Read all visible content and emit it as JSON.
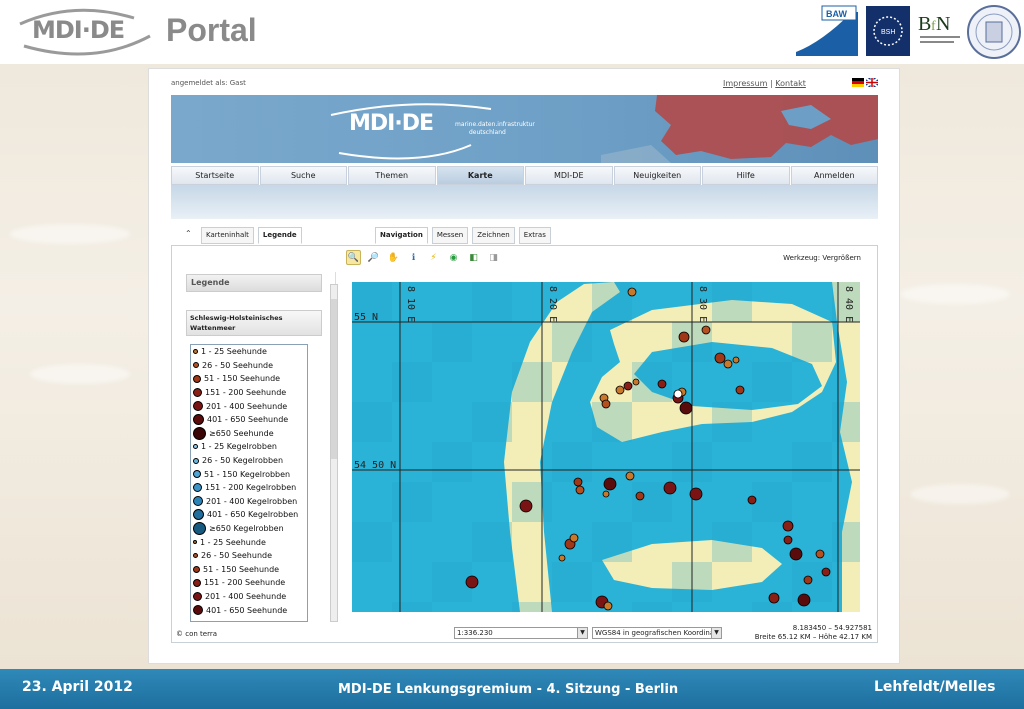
{
  "slide": {
    "logo_text": "MDI·DE",
    "title": "Portal",
    "partner_logos": [
      "BAW",
      "BSH",
      "BfN",
      "university-seal"
    ]
  },
  "browser": {
    "login_status": "angemeldet als: Gast",
    "top_links": [
      "Impressum",
      "Kontakt"
    ],
    "flags": [
      "flag-de-icon",
      "flag-uk-icon"
    ],
    "banner": {
      "logo": "MDI·DE",
      "tagline_line1": "marine.daten.infrastruktur",
      "tagline_line2": "deutschland"
    },
    "nav_tabs": [
      {
        "label": "Startseite",
        "active": false
      },
      {
        "label": "Suche",
        "active": false
      },
      {
        "label": "Themen",
        "active": false
      },
      {
        "label": "Karte",
        "active": true
      },
      {
        "label": "MDI-DE",
        "active": false
      },
      {
        "label": "Neuigkeiten",
        "active": false
      },
      {
        "label": "Hilfe",
        "active": false
      },
      {
        "label": "Anmelden",
        "active": false
      }
    ],
    "left_tabs": [
      {
        "label": "Karteninhalt",
        "active": false
      },
      {
        "label": "Legende",
        "active": true
      }
    ],
    "right_tabs": [
      {
        "label": "Navigation",
        "active": true
      },
      {
        "label": "Messen",
        "active": false
      },
      {
        "label": "Zeichnen",
        "active": false
      },
      {
        "label": "Extras",
        "active": false
      }
    ],
    "toolbar_icons": [
      "zoom-in-icon",
      "zoom-out-icon",
      "pan-hand-icon",
      "info-icon",
      "lightning-icon",
      "globe-icon",
      "back-icon",
      "forward-icon"
    ],
    "werkzeug": "Werkzeug: Vergrößern",
    "legend": {
      "header": "Legende",
      "group_title": "Schleswig-Holsteinisches Wattenmeer",
      "items": [
        {
          "label": "1 - 25 Seehunde",
          "color": "#c8782a",
          "size": 5
        },
        {
          "label": "26 - 50 Seehunde",
          "color": "#b55020",
          "size": 6
        },
        {
          "label": "51 - 150 Seehunde",
          "color": "#a03818",
          "size": 8
        },
        {
          "label": "151 - 200 Seehunde",
          "color": "#8a1f16",
          "size": 9
        },
        {
          "label": "201 - 400 Seehunde",
          "color": "#7a1414",
          "size": 10
        },
        {
          "label": "401 - 650 Seehunde",
          "color": "#5a0c0c",
          "size": 11
        },
        {
          "label": "≥650 Seehunde",
          "color": "#3a0505",
          "size": 13
        },
        {
          "label": "1 - 25 Kegelrobben",
          "color": "#8fd0ee",
          "size": 5
        },
        {
          "label": "26 - 50 Kegelrobben",
          "color": "#6ab8e0",
          "size": 6
        },
        {
          "label": "51 - 150 Kegelrobben",
          "color": "#4ea6d6",
          "size": 8
        },
        {
          "label": "151 - 200 Kegelrobben",
          "color": "#3a94c8",
          "size": 9
        },
        {
          "label": "201 - 400 Kegelrobben",
          "color": "#2b84b8",
          "size": 10
        },
        {
          "label": "401 - 650 Kegelrobben",
          "color": "#1f6e9e",
          "size": 11
        },
        {
          "label": "≥650 Kegelrobben",
          "color": "#175a7f",
          "size": 13
        },
        {
          "label": "1 - 25 Seehunde",
          "color": "#c8782a",
          "size": 4
        },
        {
          "label": "26 - 50 Seehunde",
          "color": "#b55020",
          "size": 5
        },
        {
          "label": "51 - 150 Seehunde",
          "color": "#a03818",
          "size": 7
        },
        {
          "label": "151 - 200 Seehunde",
          "color": "#8a1f16",
          "size": 8
        },
        {
          "label": "201 - 400 Seehunde",
          "color": "#7a1414",
          "size": 9
        },
        {
          "label": "401 - 650 Seehunde",
          "color": "#5a0c0c",
          "size": 10
        }
      ]
    },
    "map": {
      "lon_labels": [
        "8 10 E",
        "8 20 E",
        "8 30 E",
        "8 40 E"
      ],
      "lat_labels": [
        "55 N",
        "54 50 N"
      ],
      "water_color": "#2ab3d6",
      "land_color": "#f3eeb8"
    },
    "status": {
      "copyright": "© con terra",
      "scale": "1:336.230",
      "crs": "WGS84 in geografischen Koordinaten",
      "coords": "8.183450 – 54.927581",
      "extent": "Breite 65.12 KM – Höhe 42.17 KM"
    }
  },
  "footer": {
    "date": "23. April 2012",
    "center": "MDI-DE Lenkungsgremium - 4. Sitzung - Berlin",
    "authors": "Lehfeldt/Melles"
  },
  "colors": {
    "footer_blue": "#2483b4",
    "banner_blue": "#6d9fc6",
    "title_gray": "#8a8a8a"
  }
}
